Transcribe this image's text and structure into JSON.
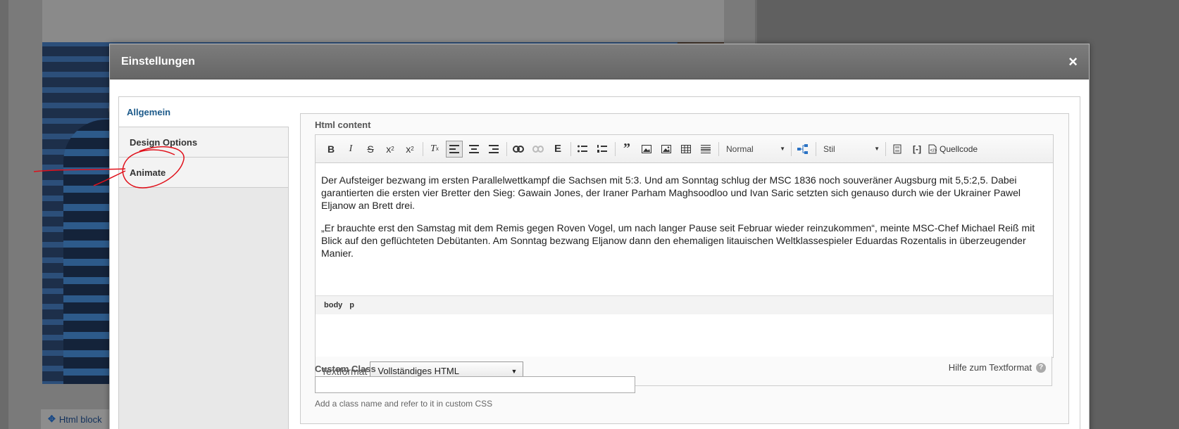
{
  "background": {
    "html_block_tab_label": "Html block"
  },
  "modal": {
    "title": "Einstellungen",
    "close_glyph": "×",
    "tabs": [
      {
        "label": "Allgemein"
      },
      {
        "label": "Design Options"
      },
      {
        "label": "Animate"
      }
    ],
    "html_content_label": "Html content",
    "toolbar": {
      "format_combo": "Normal",
      "style_combo": "Stil",
      "source_label": "Quellcode"
    },
    "editor": {
      "paragraphs": [
        "Der Aufsteiger bezwang im ersten Parallelwettkampf die Sachsen mit 5:3. Und am Sonntag schlug der MSC 1836 noch souveräner Augsburg mit 5,5:2,5. Dabei garantierten die ersten vier Bretter den Sieg: Gawain Jones, der Iraner Parham Maghsoodloo und Ivan Saric setzten sich genauso durch wie der Ukrainer Pawel Eljanow an Brett drei.",
        "„Er brauchte erst den Samstag mit dem Remis gegen Roven Vogel, um nach langer Pause seit Februar wieder reinzukommen“, meinte MSC-Chef Michael Reiß mit Blick auf den geflüchteten Debütanten. Am Sonntag bezwang Eljanow dann den ehemaligen litauischen Weltklassespieler Eduardas Rozentalis in überzeugender Manier."
      ],
      "path": [
        "body",
        "p"
      ]
    },
    "textformat": {
      "label": "Textformat",
      "selected": "Vollständiges HTML",
      "help_label": "Hilfe zum Textformat",
      "help_icon": "?"
    },
    "custom_class": {
      "label": "Custom Class",
      "value": "",
      "hint": "Add a class name and refer to it in custom CSS"
    }
  },
  "colors": {
    "active_tab_text": "#1c5a8a",
    "header_bg": "#6e6e6e",
    "annotation": "#e0101a"
  }
}
